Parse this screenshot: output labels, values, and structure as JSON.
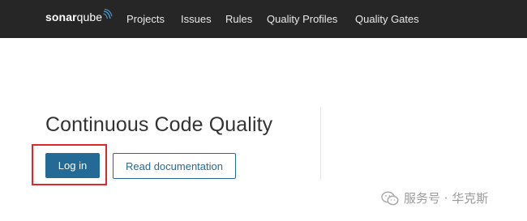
{
  "navbar": {
    "logo": {
      "bold": "sonar",
      "light": "qube"
    },
    "items": [
      {
        "label": "Projects"
      },
      {
        "label": "Issues"
      },
      {
        "label": "Rules"
      },
      {
        "label": "Quality Profiles"
      },
      {
        "label": "Quality Gates"
      }
    ]
  },
  "main": {
    "title": "Continuous Code Quality",
    "login_label": "Log in",
    "docs_label": "Read documentation"
  },
  "watermark": {
    "text": "服务号 · 华克斯"
  },
  "colors": {
    "navbar_bg": "#262626",
    "primary": "#236a97",
    "highlight": "#e0282c"
  }
}
